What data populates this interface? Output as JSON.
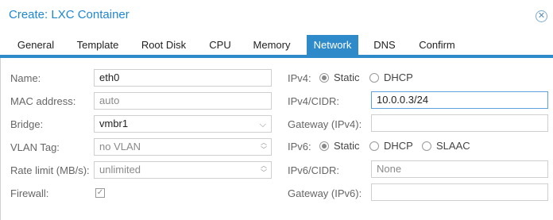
{
  "window": {
    "title": "Create: LXC Container",
    "close_icon": "close-icon"
  },
  "tabs": [
    {
      "label": "General"
    },
    {
      "label": "Template"
    },
    {
      "label": "Root Disk"
    },
    {
      "label": "CPU"
    },
    {
      "label": "Memory"
    },
    {
      "label": "Network",
      "active": true
    },
    {
      "label": "DNS"
    },
    {
      "label": "Confirm"
    }
  ],
  "accent_color": "#2f8ac9",
  "left": {
    "name": {
      "label": "Name:",
      "value": "eth0"
    },
    "mac": {
      "label": "MAC address:",
      "placeholder": "auto"
    },
    "bridge": {
      "label": "Bridge:",
      "value": "vmbr1"
    },
    "vlan": {
      "label": "VLAN Tag:",
      "placeholder": "no VLAN"
    },
    "rate": {
      "label": "Rate limit (MB/s):",
      "placeholder": "unlimited"
    },
    "firewall": {
      "label": "Firewall:",
      "checked": true
    }
  },
  "right": {
    "ipv4": {
      "label": "IPv4:",
      "options": [
        "Static",
        "DHCP"
      ],
      "selected": "Static"
    },
    "ipv4_cidr": {
      "label": "IPv4/CIDR:",
      "value": "10.0.0.3/24"
    },
    "gateway4": {
      "label": "Gateway (IPv4):",
      "value": ""
    },
    "ipv6": {
      "label": "IPv6:",
      "options": [
        "Static",
        "DHCP",
        "SLAAC"
      ],
      "selected": "Static"
    },
    "ipv6_cidr": {
      "label": "IPv6/CIDR:",
      "placeholder": "None"
    },
    "gateway6": {
      "label": "Gateway (IPv6):",
      "value": ""
    }
  }
}
